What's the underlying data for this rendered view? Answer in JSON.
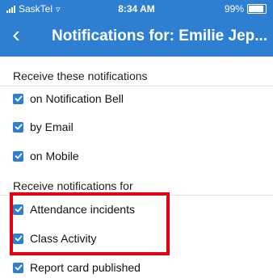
{
  "status_bar": {
    "carrier": "SaskTel",
    "time": "8:34 AM",
    "battery_text": "99%",
    "battery_level": 0.99
  },
  "header": {
    "title": "Notifications for: Emilie Jep...",
    "back_icon": "chevron-left-icon"
  },
  "sections": [
    {
      "label": "Receive these notifications",
      "items": [
        {
          "label": "on Notification Bell",
          "checked": true
        },
        {
          "label": "by Email",
          "checked": true
        },
        {
          "label": "on Mobile",
          "checked": true
        }
      ]
    },
    {
      "label": "Receive notifications for",
      "items": [
        {
          "label": "Attendance incidents",
          "checked": true
        },
        {
          "label": "Class Activity",
          "checked": true
        },
        {
          "label": "Report card published",
          "checked": true
        }
      ]
    }
  ],
  "colors": {
    "brand_blue": "#2E7FD1",
    "highlight_red": "#E3000F"
  }
}
